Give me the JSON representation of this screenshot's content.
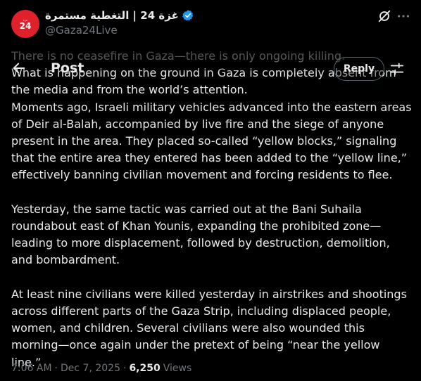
{
  "author": {
    "display_name": "غزة 24 | التغطية مستمرة",
    "handle": "@Gaza24Live",
    "avatar_text": "24",
    "avatar_subtext": "غزة"
  },
  "header": {
    "title": "Post",
    "reply_label": "Reply"
  },
  "post": {
    "text": "There is no ceasefire in Gaza—there is only ongoing killing.\nWhat is happening on the ground in Gaza is completely absent from the media and from the world’s attention.\nMoments ago, Israeli military vehicles advanced into the eastern areas of Deir al-Balah, accompanied by live fire and the siege of anyone present in the area. They placed so-called “yellow blocks,” signaling that the entire area they entered has been added to the “yellow line,” effectively banning civilian movement and forcing residents to flee.\n\nYesterday, the same tactic was carried out at the Bani Suhaila roundabout east of Khan Younis, expanding the prohibited zone—leading to more displacement, followed by destruction, demolition, and bombardment.\n\nAt least nine civilians were killed yesterday in airstrikes and shootings across different parts of the Gaza Strip, including displaced people, women, and children. Several civilians were also wounded this morning—once again under the pretext of being “near the yellow line.”"
  },
  "meta": {
    "time": "7:06 AM",
    "separator": "·",
    "date": "Dec 7, 2025",
    "views_count": "6,250",
    "views_label": "Views"
  },
  "icons": {
    "verified": "verified-badge-icon",
    "grok": "grok-icon",
    "more": "more-icon",
    "back": "back-arrow-icon",
    "settings": "settings-icon"
  },
  "colors": {
    "background": "#000000",
    "text": "#e7e9ea",
    "secondary": "#71767b",
    "verified": "#1d9bf0",
    "avatar": "#e0202a"
  }
}
